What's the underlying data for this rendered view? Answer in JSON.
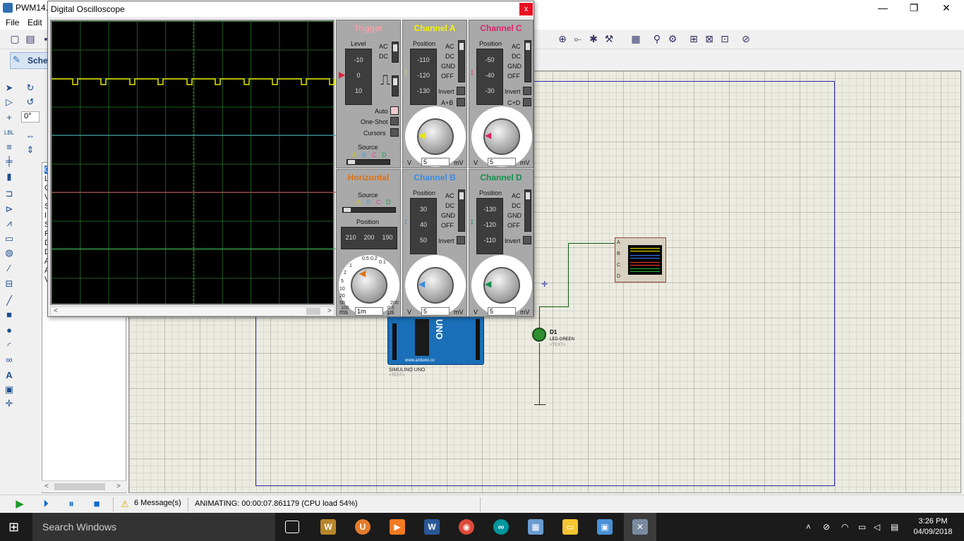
{
  "window": {
    "title": "PWM14...",
    "controls": [
      "—",
      "❐",
      "✕"
    ]
  },
  "menu": {
    "file": "File",
    "edit": "Edit"
  },
  "tab": {
    "label": "Sche"
  },
  "rotation_field": "0°",
  "device_letters": [
    "C",
    "L",
    "C",
    "V",
    "S",
    "I",
    "S",
    "P",
    "D",
    "D",
    "A",
    "A",
    "V"
  ],
  "oscilloscope": {
    "title": "Digital Oscilloscope",
    "close": "x",
    "trigger": {
      "title": "Trigger",
      "level_label": "Level",
      "level_ticks": [
        "-10",
        "0",
        "10"
      ],
      "ac": "AC",
      "dc": "DC",
      "auto": "Auto",
      "one_shot": "One-Shot",
      "cursors": "Cursors",
      "source_label": "Source",
      "source_letters": [
        "A",
        "B",
        "C",
        "D"
      ]
    },
    "horizontal": {
      "title": "Horizontal",
      "source_label": "Source",
      "source_letters": [
        "A",
        "B",
        "C",
        "D"
      ],
      "position_label": "Position",
      "position_ticks": [
        "210",
        "200",
        "190"
      ],
      "dial_numbers": [
        "0.5",
        "0.2",
        "0.1",
        "1",
        "2",
        "5",
        "10",
        "20",
        "50",
        "100",
        "200",
        "0.5"
      ],
      "unit_left": "ms",
      "unit_right": "μs",
      "value": "1m"
    },
    "channels": [
      {
        "title": "Channel A",
        "color": "#ffff00",
        "position_label": "Position",
        "ticks": [
          "-110",
          "-120",
          "-130"
        ],
        "modes": [
          "AC",
          "DC",
          "GND",
          "OFF"
        ],
        "invert": "Invert",
        "combine": "A+B",
        "unit_left": "V",
        "unit_right": "mV",
        "value": "5"
      },
      {
        "title": "Channel C",
        "color": "#ff1493",
        "position_label": "Position",
        "ticks": [
          "-50",
          "-40",
          "-30"
        ],
        "modes": [
          "AC",
          "DC",
          "GND",
          "OFF"
        ],
        "invert": "Invert",
        "combine": "C+D",
        "unit_left": "V",
        "unit_right": "mV",
        "value": "5"
      },
      {
        "title": "Channel B",
        "color": "#1e90ff",
        "position_label": "Position",
        "ticks": [
          "30",
          "40",
          "50"
        ],
        "modes": [
          "AC",
          "DC",
          "GND",
          "OFF"
        ],
        "invert": "Invert",
        "combine": "",
        "unit_left": "V",
        "unit_right": "mV",
        "value": "5"
      },
      {
        "title": "Channel D",
        "color": "#00a040",
        "position_label": "Position",
        "ticks": [
          "-130",
          "-120",
          "-110"
        ],
        "modes": [
          "AC",
          "DC",
          "GND",
          "OFF"
        ],
        "invert": "Invert",
        "combine": "",
        "unit_left": "V",
        "unit_right": "mV",
        "value": "5"
      }
    ],
    "dial_numbers": [
      "0.5",
      "0.2",
      "0.1",
      "1",
      "2",
      "5",
      "10",
      "20",
      "50",
      "2",
      "5",
      "10",
      "20",
      "V"
    ]
  },
  "circuit": {
    "arduino_label": "SIMULINO UNO",
    "arduino_text": "<TEXT>",
    "arduino_logo": "UNO",
    "arduino_www": "www.arduino.cc",
    "led_label": "D1",
    "led_sub": "LED-GREEN",
    "led_text": "<TEXT>",
    "scope_pins": [
      "A",
      "B",
      "C",
      "D"
    ]
  },
  "status": {
    "messages": "6 Message(s)",
    "animating": "ANIMATING: 00:00:07.861179 (CPU load 54%)"
  },
  "taskbar": {
    "search": "Search Windows",
    "time": "3:26 PM",
    "date": "04/09/2018"
  }
}
